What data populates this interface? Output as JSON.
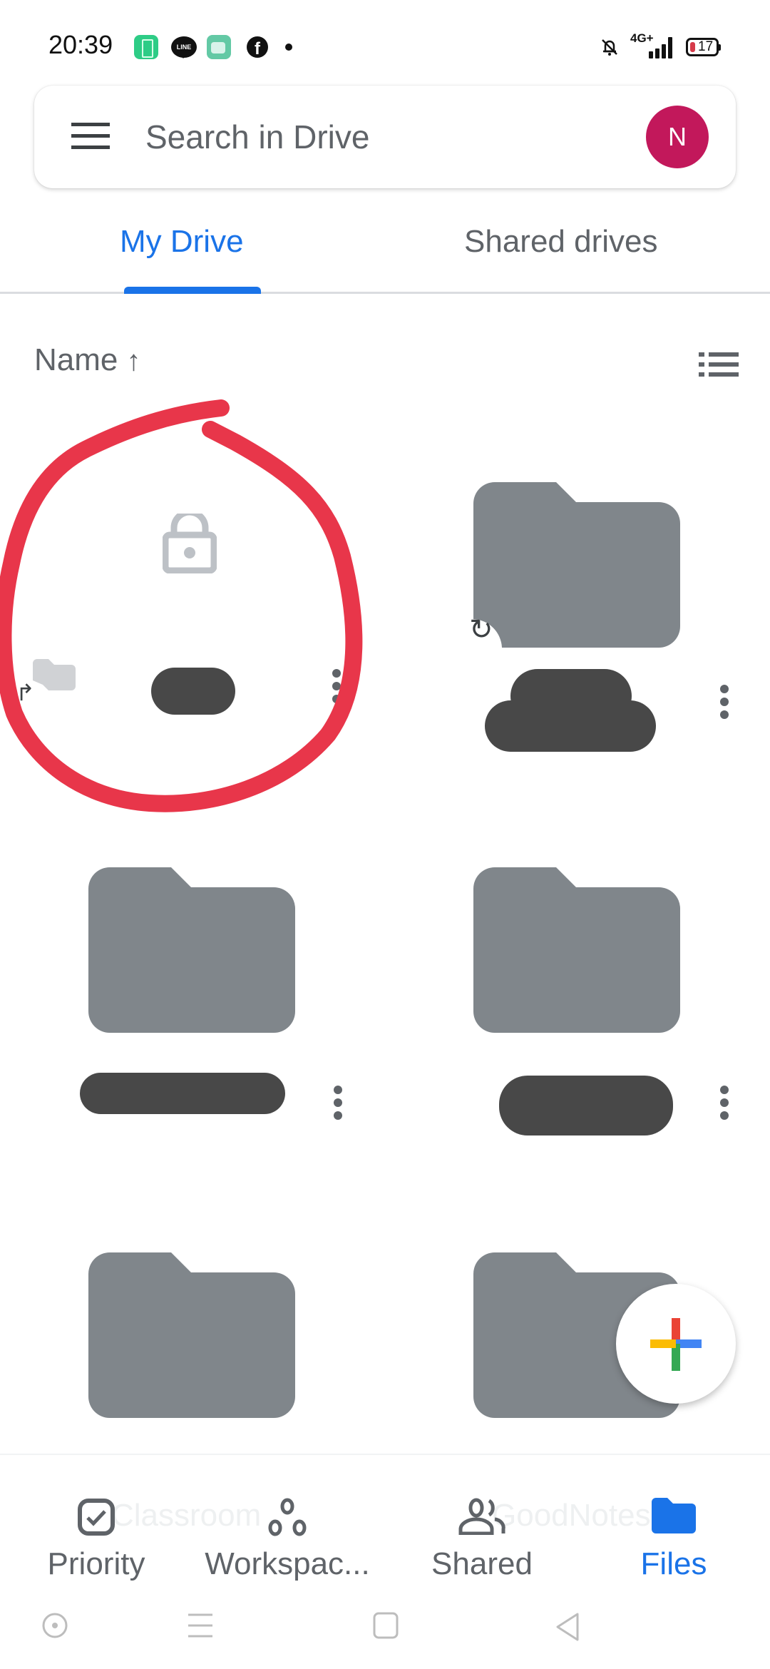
{
  "status_bar": {
    "time": "20:39",
    "notification_icons": [
      "battery-saver-app-icon",
      "line-app-icon",
      "messages-app-icon",
      "facebook-app-icon",
      "more-notifications-dot"
    ],
    "line_label": "LINE",
    "facebook_label": "f",
    "network": "4G+",
    "battery_level": "17",
    "silent_mode": true
  },
  "search": {
    "placeholder": "Search in Drive",
    "value": "",
    "avatar_initial": "N",
    "avatar_color": "#c2185b"
  },
  "tabs": [
    {
      "label": "My Drive",
      "active": true
    },
    {
      "label": "Shared drives",
      "active": false
    }
  ],
  "sort": {
    "label": "Name",
    "direction_icon": "↑",
    "view_toggle": "list-view-icon"
  },
  "items": [
    {
      "type": "shortcut-restricted",
      "name": "[redacted]",
      "thumbnail": "lock-icon",
      "annotated": true
    },
    {
      "type": "folder-shortcut",
      "name": "[redacted]"
    },
    {
      "type": "folder",
      "name": "[redacted]"
    },
    {
      "type": "folder",
      "name": "[redacted]"
    },
    {
      "type": "folder",
      "name": "Classroom"
    },
    {
      "type": "folder",
      "name": "GoodNotes"
    }
  ],
  "fab": {
    "label": "New",
    "colors": [
      "#ea4335",
      "#4285f4",
      "#34a853",
      "#fbbc04"
    ]
  },
  "bottom_nav": [
    {
      "label": "Priority",
      "icon": "priority-checkbox-icon",
      "active": false
    },
    {
      "label": "Workspac...",
      "icon": "workspaces-icon",
      "active": false
    },
    {
      "label": "Shared",
      "icon": "shared-people-icon",
      "active": false
    },
    {
      "label": "Files",
      "icon": "folder-icon",
      "active": true
    }
  ],
  "colors": {
    "accent": "#1a73e8",
    "annotation": "#e8364a",
    "folder": "#80868b",
    "redaction": "#484848"
  }
}
